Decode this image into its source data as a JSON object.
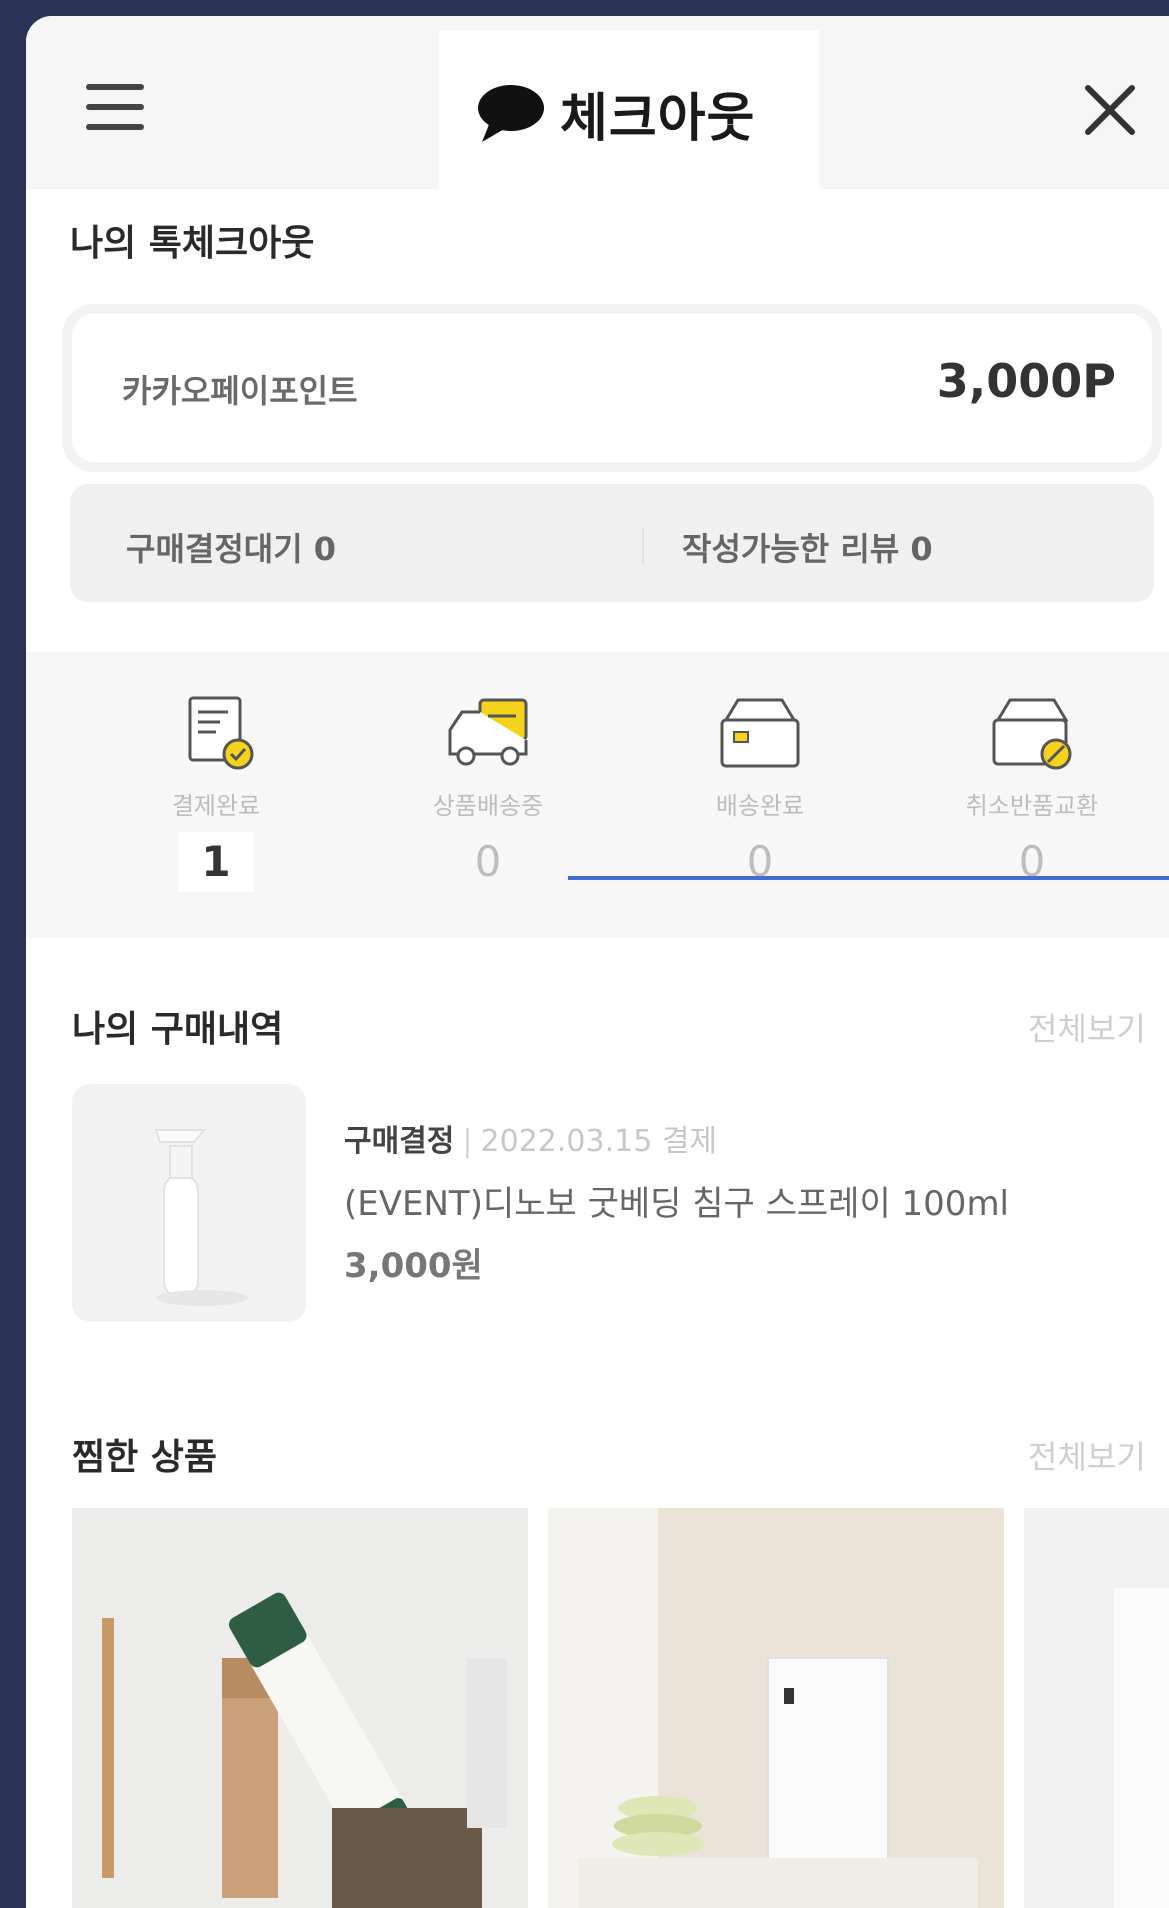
{
  "header": {
    "title": "체크아웃"
  },
  "my_checkout": {
    "section_title": "나의 톡체크아웃",
    "point_label": "카카오페이포인트",
    "point_value": "3,000P",
    "pending_purchase": "구매결정대기 0",
    "pending_reviews": "작성가능한 리뷰 0"
  },
  "status": [
    {
      "label": "결제완료",
      "count": "1",
      "icon": "order-complete-icon"
    },
    {
      "label": "상품배송중",
      "count": "0",
      "icon": "delivery-truck-icon"
    },
    {
      "label": "배송완료",
      "count": "0",
      "icon": "package-box-icon"
    },
    {
      "label": "취소반품교환",
      "count": "0",
      "icon": "return-box-icon"
    }
  ],
  "purchase_history": {
    "section_title": "나의 구매내역",
    "see_all": "전체보기",
    "item": {
      "status": "구매결정",
      "date": "2022.03.15 결제",
      "name": "(EVENT)디노보 굿베딩 침구 스프레이 100ml",
      "price": "3,000원"
    }
  },
  "liked_products": {
    "section_title": "찜한 상품",
    "see_all": "전체보기"
  },
  "colors": {
    "accent_yellow": "#f5d31c",
    "highlight_blue": "#3e6fd0",
    "background_navy": "#2b3456"
  }
}
